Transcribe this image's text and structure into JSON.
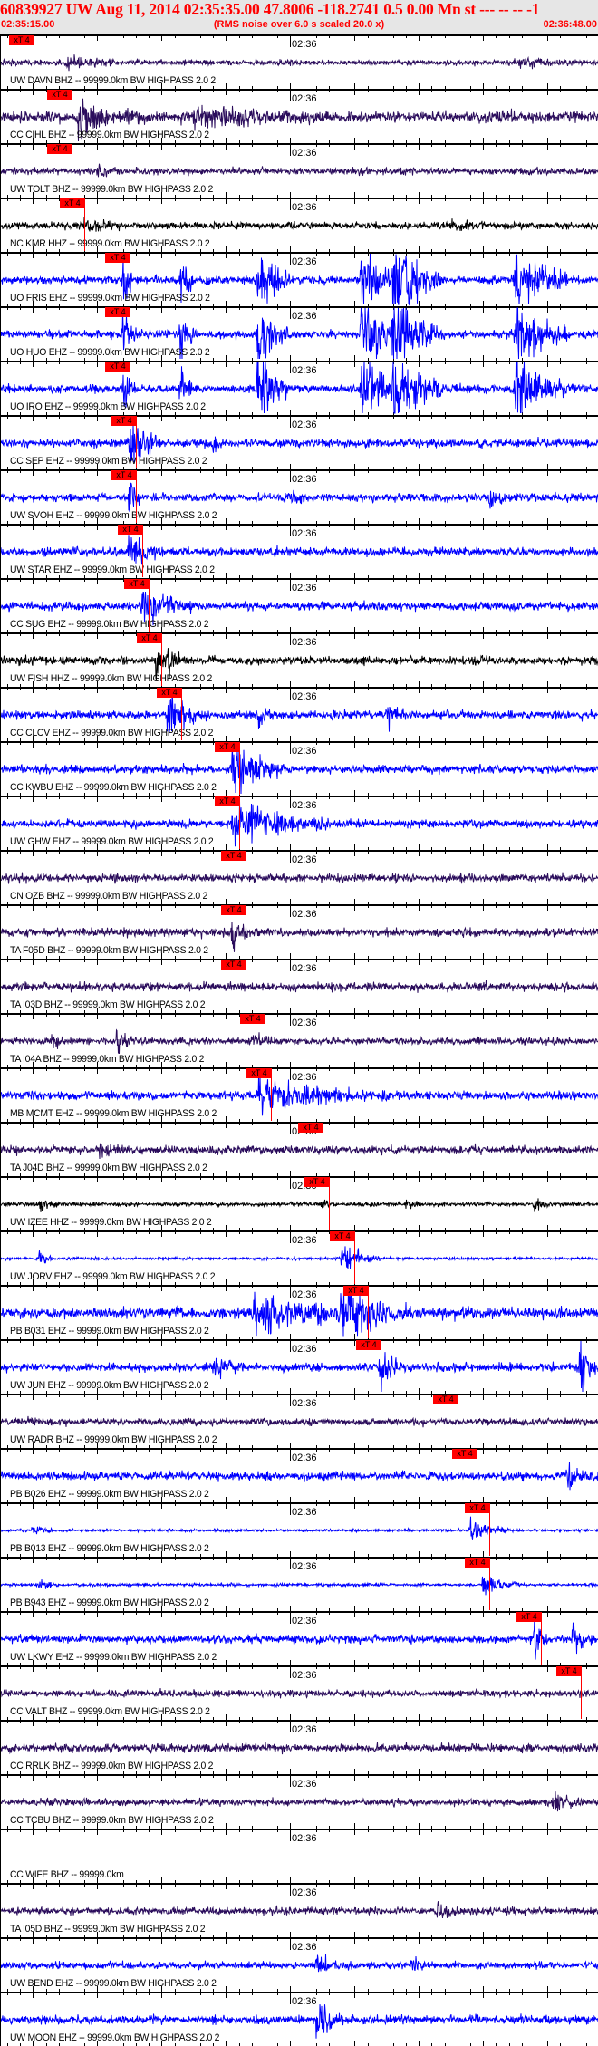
{
  "header": {
    "title": "60839927 UW Aug 11, 2014 02:35:35.00   47.8006 -118.2741  0.5 0.00 Mn st --- -- --  -1",
    "start_time": "02:35:15.00",
    "note": "(RMS noise over 6.0 s scaled 20.0 x)",
    "end_time": "02:36:48.00"
  },
  "colors": {
    "BHZ": "#2b0d5c",
    "EHZ": "#0000ff",
    "HHZ": "#000000",
    "pick": "#ff0000"
  },
  "chart_data": {
    "type": "line",
    "title": "60839927 UW Aug 11, 2014 02:35:35.00",
    "x_unit": "seconds after 02:35:15.00",
    "xlim": [
      0,
      93
    ],
    "minute_tick_s": 45,
    "minute_label": "02:36",
    "pick_label": "xT 4",
    "traces": [
      {
        "label": "UW DAVN BHZ -- 99999.0km BW  HIGHPASS  2.0  2",
        "ch": "BHZ",
        "pick_s": 5.1,
        "noise": 2,
        "bursts": [
          [
            10,
            5,
            8
          ],
          [
            80,
            3,
            10
          ]
        ]
      },
      {
        "label": "CC CIHL BHZ -- 99999.0km BW  HIGHPASS  2.0  2",
        "ch": "BHZ",
        "pick_s": 11.0,
        "noise": 4,
        "bursts": [
          [
            12,
            12,
            10
          ],
          [
            30,
            6,
            20
          ]
        ]
      },
      {
        "label": "UW TOLT BHZ -- 99999.0km BW  HIGHPASS  2.0  2",
        "ch": "BHZ",
        "pick_s": 11.0,
        "noise": 2.5,
        "bursts": [
          [
            15,
            4,
            5
          ]
        ]
      },
      {
        "label": "NC KMR HHZ -- 99999.0km BW  HIGHPASS  2.0  2",
        "ch": "HHZ",
        "pick_s": 13.0,
        "noise": 2.5,
        "bursts": [
          [
            13,
            5,
            6
          ],
          [
            70,
            4,
            5
          ]
        ]
      },
      {
        "label": "UO FRIS EHZ -- 99999.0km BW  HIGHPASS  2.0  2",
        "ch": "EHZ",
        "pick_s": 20.0,
        "noise": 3,
        "bursts": [
          [
            19,
            20,
            2
          ],
          [
            28,
            25,
            2
          ],
          [
            40,
            30,
            5
          ],
          [
            56,
            30,
            6
          ],
          [
            61,
            30,
            8
          ],
          [
            80,
            30,
            8
          ]
        ]
      },
      {
        "label": "UO HUO EHZ -- 99999.0km BW  HIGHPASS  2.0  2",
        "ch": "EHZ",
        "pick_s": 20.0,
        "noise": 3,
        "bursts": [
          [
            19,
            20,
            2
          ],
          [
            28,
            22,
            2
          ],
          [
            40,
            30,
            5
          ],
          [
            56,
            30,
            6
          ],
          [
            61,
            30,
            8
          ],
          [
            80,
            30,
            8
          ]
        ]
      },
      {
        "label": "UO IRO EHZ -- 99999.0km BW  HIGHPASS  2.0  2",
        "ch": "EHZ",
        "pick_s": 20.0,
        "noise": 3,
        "bursts": [
          [
            19,
            20,
            2
          ],
          [
            28,
            22,
            2
          ],
          [
            40,
            30,
            5
          ],
          [
            56,
            30,
            6
          ],
          [
            61,
            30,
            8
          ],
          [
            80,
            30,
            8
          ]
        ]
      },
      {
        "label": "CC SEP EHZ -- 99999.0km BW  HIGHPASS  2.0  2",
        "ch": "EHZ",
        "pick_s": 21.0,
        "noise": 3,
        "bursts": [
          [
            20,
            25,
            5
          ],
          [
            33,
            8,
            2
          ]
        ]
      },
      {
        "label": "UW SVOH EHZ -- 99999.0km BW  HIGHPASS  2.0  2",
        "ch": "EHZ",
        "pick_s": 21.0,
        "noise": 3,
        "bursts": [
          [
            20,
            20,
            2
          ],
          [
            44,
            6,
            3
          ],
          [
            76,
            6,
            3
          ]
        ]
      },
      {
        "label": "UW STAR EHZ -- 99999.0km BW  HIGHPASS  2.0  2",
        "ch": "EHZ",
        "pick_s": 22.0,
        "noise": 3,
        "bursts": [
          [
            20,
            18,
            4
          ]
        ]
      },
      {
        "label": "CC SUG EHZ -- 99999.0km BW  HIGHPASS  2.0  2",
        "ch": "EHZ",
        "pick_s": 23.0,
        "noise": 3,
        "bursts": [
          [
            22,
            15,
            8
          ]
        ]
      },
      {
        "label": "UW FISH HHZ -- 99999.0km BW  HIGHPASS  2.0  2",
        "ch": "HHZ",
        "pick_s": 24.9,
        "noise": 3,
        "bursts": [
          [
            24,
            16,
            2
          ],
          [
            26,
            18,
            2
          ]
        ]
      },
      {
        "label": "CC CLCV EHZ -- 99999.0km BW  HIGHPASS  2.0  2",
        "ch": "EHZ",
        "pick_s": 28.0,
        "noise": 3,
        "bursts": [
          [
            26,
            15,
            6
          ],
          [
            40,
            8,
            3
          ],
          [
            60,
            8,
            3
          ]
        ]
      },
      {
        "label": "CC KWBU EHZ -- 99999.0km BW  HIGHPASS  2.0  2",
        "ch": "EHZ",
        "pick_s": 37.1,
        "noise": 3,
        "bursts": [
          [
            36,
            20,
            8
          ]
        ]
      },
      {
        "label": "UW GHW EHZ -- 99999.0km BW  HIGHPASS  2.0  2",
        "ch": "EHZ",
        "pick_s": 37.1,
        "noise": 3,
        "bursts": [
          [
            36,
            15,
            15
          ]
        ]
      },
      {
        "label": "CN OZB BHZ -- 99999.0km BW  HIGHPASS  2.0  2",
        "ch": "BHZ",
        "pick_s": 38.0,
        "noise": 3,
        "bursts": []
      },
      {
        "label": "TA F05D BHZ -- 99999.0km BW  HIGHPASS  2.0  2",
        "ch": "BHZ",
        "pick_s": 38.0,
        "noise": 3,
        "bursts": [
          [
            36,
            12,
            3
          ]
        ]
      },
      {
        "label": "TA I03D BHZ -- 99999.0km BW  HIGHPASS  2.0  2",
        "ch": "BHZ",
        "pick_s": 38.0,
        "noise": 3,
        "bursts": []
      },
      {
        "label": "TA I04A BHZ -- 99999.0km BW  HIGHPASS  2.0  2",
        "ch": "BHZ",
        "pick_s": 41.0,
        "noise": 2.5,
        "bursts": [
          [
            8,
            6,
            3
          ],
          [
            18,
            8,
            3
          ],
          [
            39,
            4,
            5
          ]
        ]
      },
      {
        "label": "MB MCMT EHZ -- 99999.0km BW  HIGHPASS  2.0  2",
        "ch": "EHZ",
        "pick_s": 42.0,
        "noise": 3,
        "bursts": [
          [
            40,
            12,
            20
          ]
        ]
      },
      {
        "label": "TA J04D BHZ -- 99999.0km BW  HIGHPASS  2.0  2",
        "ch": "BHZ",
        "pick_s": 50.0,
        "noise": 3,
        "bursts": [
          [
            15,
            5,
            4
          ]
        ]
      },
      {
        "label": "UW IZEE HHZ -- 99999.0km BW  HIGHPASS  2.0  2",
        "ch": "HHZ",
        "pick_s": 51.0,
        "noise": 1.5,
        "bursts": [
          [
            6,
            4,
            3
          ],
          [
            50,
            3,
            2
          ],
          [
            63,
            3,
            2
          ],
          [
            83,
            4,
            3
          ]
        ]
      },
      {
        "label": "UW JORV EHZ -- 99999.0km BW  HIGHPASS  2.0  2",
        "ch": "EHZ",
        "pick_s": 55.0,
        "noise": 1,
        "bursts": [
          [
            6,
            6,
            2
          ],
          [
            53,
            12,
            6
          ]
        ]
      },
      {
        "label": "PB B031 EHZ -- 99999.0km BW  HIGHPASS  2.0  2",
        "ch": "EHZ",
        "pick_s": 57.1,
        "noise": 4,
        "bursts": [
          [
            39,
            12,
            20
          ],
          [
            53,
            20,
            10
          ]
        ]
      },
      {
        "label": "UW JUN EHZ -- 99999.0km BW  HIGHPASS  2.0  2",
        "ch": "EHZ",
        "pick_s": 59.0,
        "noise": 3,
        "bursts": [
          [
            33,
            8,
            5
          ],
          [
            59,
            20,
            3
          ],
          [
            90,
            20,
            3
          ]
        ]
      },
      {
        "label": "UW RADR BHZ -- 99999.0km BW  HIGHPASS  2.0  2",
        "ch": "BHZ",
        "pick_s": 71.0,
        "noise": 2.5,
        "bursts": []
      },
      {
        "label": "PB B026 EHZ -- 99999.0km BW  HIGHPASS  2.0  2",
        "ch": "EHZ",
        "pick_s": 74.0,
        "noise": 3,
        "bursts": [
          [
            88,
            10,
            3
          ]
        ]
      },
      {
        "label": "PB B013 EHZ -- 99999.0km BW  HIGHPASS  2.0  2",
        "ch": "EHZ",
        "pick_s": 75.9,
        "noise": 1,
        "bursts": [
          [
            5,
            4,
            3
          ],
          [
            73,
            8,
            6
          ]
        ]
      },
      {
        "label": "PB B943 EHZ -- 99999.0km BW  HIGHPASS  2.0  2",
        "ch": "EHZ",
        "pick_s": 75.9,
        "noise": 1,
        "bursts": [
          [
            6,
            5,
            3
          ],
          [
            75,
            8,
            6
          ]
        ]
      },
      {
        "label": "UW LKWY EHZ -- 99999.0km BW  HIGHPASS  2.0  2",
        "ch": "EHZ",
        "pick_s": 84.0,
        "noise": 3,
        "bursts": [
          [
            83,
            14,
            2
          ],
          [
            89,
            10,
            3
          ]
        ]
      },
      {
        "label": "CC VALT BHZ -- 99999.0km BW  HIGHPASS  2.0  2",
        "ch": "BHZ",
        "pick_s": 90.2,
        "noise": 2.5,
        "bursts": []
      },
      {
        "label": "CC RRLK BHZ -- 99999.0km BW  HIGHPASS  2.0  2",
        "ch": "BHZ",
        "pick_s": null,
        "noise": 3,
        "bursts": []
      },
      {
        "label": "CC TCBU BHZ -- 99999.0km BW  HIGHPASS  2.0  2",
        "ch": "BHZ",
        "pick_s": null,
        "noise": 2.5,
        "bursts": [
          [
            86,
            5,
            4
          ]
        ]
      },
      {
        "label": "CC WIFE BHZ -- 99999.0km",
        "ch": "BHZ",
        "pick_s": null,
        "noise": 0,
        "bursts": []
      },
      {
        "label": "TA I05D BHZ -- 99999.0km BW  HIGHPASS  2.0  2",
        "ch": "BHZ",
        "pick_s": null,
        "noise": 2.5,
        "bursts": [
          [
            68,
            6,
            4
          ]
        ]
      },
      {
        "label": "UW BEND EHZ -- 99999.0km BW  HIGHPASS  2.0  2",
        "ch": "EHZ",
        "pick_s": null,
        "noise": 2.5,
        "bursts": [
          [
            49,
            6,
            6
          ],
          [
            64,
            5,
            3
          ]
        ]
      },
      {
        "label": "UW MOON EHZ -- 99999.0km BW  HIGHPASS  2.0  2",
        "ch": "EHZ",
        "pick_s": null,
        "noise": 3,
        "bursts": [
          [
            49,
            16,
            4
          ]
        ]
      }
    ]
  }
}
